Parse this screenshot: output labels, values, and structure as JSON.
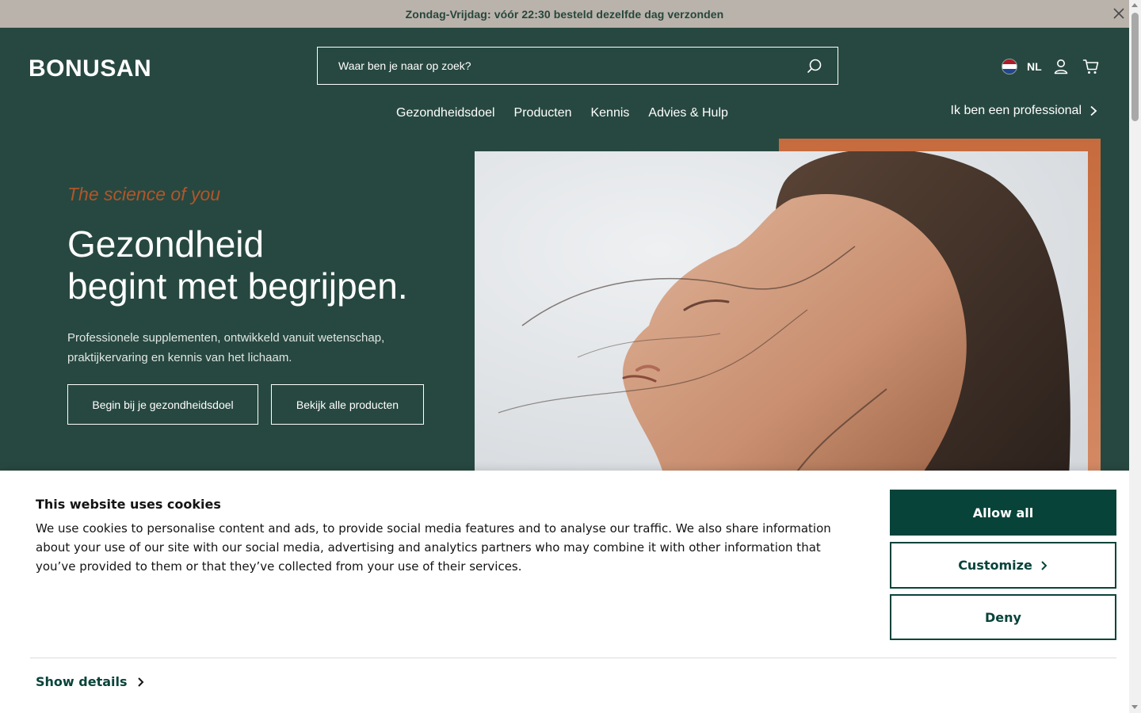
{
  "announcement": {
    "text": "Zondag-Vrijdag: vóór 22:30 besteld dezelfde dag verzonden",
    "close_icon": "close-icon"
  },
  "header": {
    "logo_text": "BONUSAN",
    "search": {
      "placeholder": "Waar ben je naar op zoek?",
      "value": "",
      "icon": "search-icon"
    },
    "language": {
      "code": "NL",
      "flag": "netherlands-flag-icon"
    },
    "icons": {
      "account": "user-icon",
      "cart": "cart-icon"
    },
    "nav": [
      "Gezondheidsdoel",
      "Producten",
      "Kennis",
      "Advies & Hulp"
    ],
    "professional_link": "Ik ben een professional"
  },
  "hero": {
    "tagline": "The science of you",
    "headline_line1": "Gezondheid",
    "headline_line2": "begint met begrijpen.",
    "description": "Professionele supplementen, ontwikkeld vanuit wetenschap, praktijkervaring en kennis van het lichaam.",
    "button_goal": "Begin bij je gezondheidsdoel",
    "button_products": "Bekijk alle producten"
  },
  "cookie": {
    "title": "This website uses cookies",
    "text": "We use cookies to personalise content and ads, to provide social media features and to analyse our traffic. We also share information about your use of our site with our social media, advertising and analytics partners who may combine it with other information that you’ve provided to them or that they’ve collected from your use of their services.",
    "allow_label": "Allow all",
    "customize_label": "Customize",
    "deny_label": "Deny",
    "details_label": "Show details"
  },
  "colors": {
    "brand_green": "#274840",
    "announcement_bg": "#bab3ab",
    "accent_orange": "#c66b3d",
    "cookie_button": "#08433a"
  }
}
